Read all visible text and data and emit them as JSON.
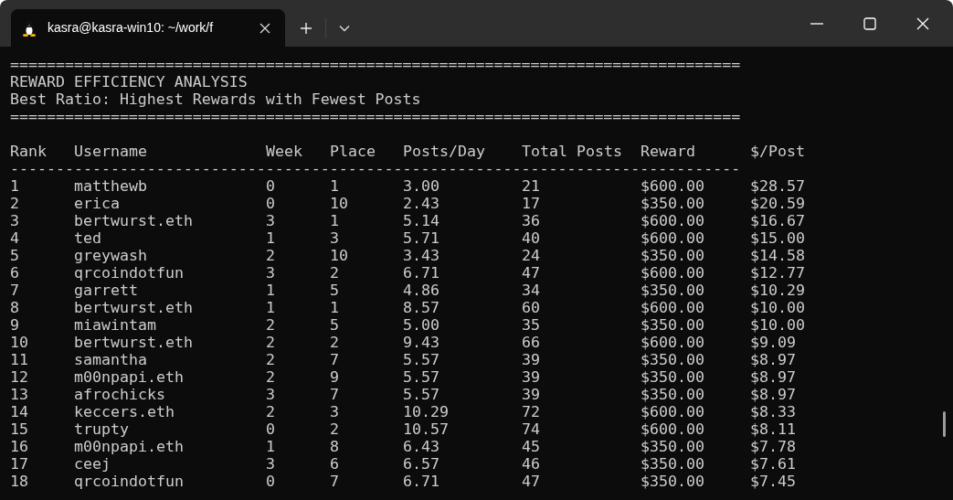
{
  "window": {
    "tab_title": "kasra@kasra-win10: ~/work/f"
  },
  "terminal": {
    "rule_top": "================================================================================",
    "heading": "REWARD EFFICIENCY ANALYSIS",
    "subheading": "Best Ratio: Highest Rewards with Fewest Posts",
    "rule_bottom": "================================================================================",
    "table": {
      "columns": [
        "Rank",
        "Username",
        "Week",
        "Place",
        "Posts/Day",
        "Total Posts",
        "Reward",
        "$/Post"
      ],
      "separator": "--------------------------------------------------------------------------------",
      "rows": [
        [
          "1",
          "matthewb",
          "0",
          "1",
          "3.00",
          "21",
          "$600.00",
          "$28.57"
        ],
        [
          "2",
          "erica",
          "0",
          "10",
          "2.43",
          "17",
          "$350.00",
          "$20.59"
        ],
        [
          "3",
          "bertwurst.eth",
          "3",
          "1",
          "5.14",
          "36",
          "$600.00",
          "$16.67"
        ],
        [
          "4",
          "ted",
          "1",
          "3",
          "5.71",
          "40",
          "$600.00",
          "$15.00"
        ],
        [
          "5",
          "greywash",
          "2",
          "10",
          "3.43",
          "24",
          "$350.00",
          "$14.58"
        ],
        [
          "6",
          "qrcoindotfun",
          "3",
          "2",
          "6.71",
          "47",
          "$600.00",
          "$12.77"
        ],
        [
          "7",
          "garrett",
          "1",
          "5",
          "4.86",
          "34",
          "$350.00",
          "$10.29"
        ],
        [
          "8",
          "bertwurst.eth",
          "1",
          "1",
          "8.57",
          "60",
          "$600.00",
          "$10.00"
        ],
        [
          "9",
          "miawintam",
          "2",
          "5",
          "5.00",
          "35",
          "$350.00",
          "$10.00"
        ],
        [
          "10",
          "bertwurst.eth",
          "2",
          "2",
          "9.43",
          "66",
          "$600.00",
          "$9.09"
        ],
        [
          "11",
          "samantha",
          "2",
          "7",
          "5.57",
          "39",
          "$350.00",
          "$8.97"
        ],
        [
          "12",
          "m00npapi.eth",
          "2",
          "9",
          "5.57",
          "39",
          "$350.00",
          "$8.97"
        ],
        [
          "13",
          "afrochicks",
          "3",
          "7",
          "5.57",
          "39",
          "$350.00",
          "$8.97"
        ],
        [
          "14",
          "keccers.eth",
          "2",
          "3",
          "10.29",
          "72",
          "$600.00",
          "$8.33"
        ],
        [
          "15",
          "trupty",
          "0",
          "2",
          "10.57",
          "74",
          "$600.00",
          "$8.11"
        ],
        [
          "16",
          "m00npapi.eth",
          "1",
          "8",
          "6.43",
          "45",
          "$350.00",
          "$7.78"
        ],
        [
          "17",
          "ceej",
          "3",
          "6",
          "6.57",
          "46",
          "$350.00",
          "$7.61"
        ],
        [
          "18",
          "qrcoindotfun",
          "0",
          "7",
          "6.71",
          "47",
          "$350.00",
          "$7.45"
        ]
      ]
    }
  }
}
